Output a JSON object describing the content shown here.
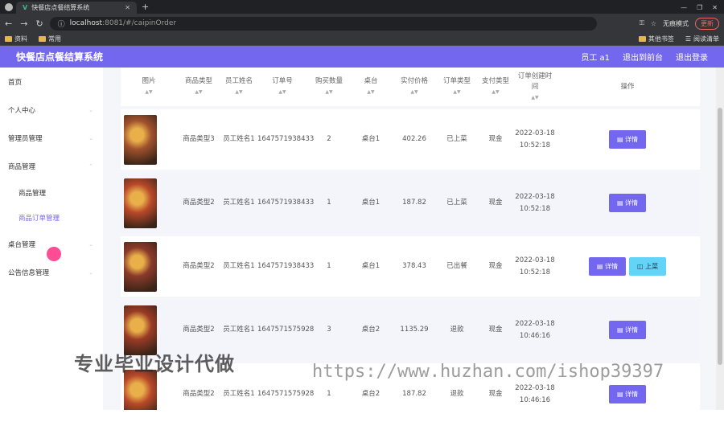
{
  "browser": {
    "tab_title": "快餐店点餐结算系统",
    "url_host": "localhost",
    "url_rest": ":8081/#/caipinOrder",
    "incognito": "无痕模式",
    "update": "更新",
    "bookmarks": [
      "资料",
      "常用"
    ],
    "bookmarks_right": [
      "其他书签",
      "阅读清单"
    ]
  },
  "app": {
    "title": "快餐店点餐结算系统",
    "user": "员工 a1",
    "back_front": "退出到前台",
    "logout": "退出登录"
  },
  "sidebar": {
    "items": [
      {
        "label": "首页"
      },
      {
        "label": "个人中心"
      },
      {
        "label": "管理员管理"
      },
      {
        "label": "商品管理"
      }
    ],
    "sub_items": [
      {
        "label": "商品管理"
      },
      {
        "label": "商品订单管理"
      }
    ],
    "items_after": [
      {
        "label": "桌台管理"
      },
      {
        "label": "公告信息管理"
      }
    ]
  },
  "table": {
    "headers": [
      "图片",
      "商品类型",
      "员工姓名",
      "订单号",
      "购买数量",
      "桌台",
      "实付价格",
      "订单类型",
      "支付类型",
      "订单创建时间",
      "操作"
    ],
    "rows": [
      {
        "img_color": "#a0522d",
        "type": "商品类型3",
        "staff": "员工姓名1",
        "order_no": "1647571938433",
        "qty": "2",
        "table": "桌台1",
        "price": "402.26",
        "order_type": "已上菜",
        "pay": "现金",
        "time": "2022-03-18 10:52:18",
        "actions": [
          "详情"
        ]
      },
      {
        "img_color": "#b8482a",
        "type": "商品类型2",
        "staff": "员工姓名1",
        "order_no": "1647571938433",
        "qty": "1",
        "table": "桌台1",
        "price": "187.82",
        "order_type": "已上菜",
        "pay": "现金",
        "time": "2022-03-18 10:52:18",
        "actions": [
          "详情"
        ]
      },
      {
        "img_color": "#8b3a2a",
        "type": "商品类型2",
        "staff": "员工姓名1",
        "order_no": "1647571938433",
        "qty": "1",
        "table": "桌台1",
        "price": "378.43",
        "order_type": "已出餐",
        "pay": "现金",
        "time": "2022-03-18 10:52:18",
        "actions": [
          "详情",
          "上菜"
        ]
      },
      {
        "img_color": "#9a3b25",
        "type": "商品类型2",
        "staff": "员工姓名1",
        "order_no": "1647571575928",
        "qty": "3",
        "table": "桌台2",
        "price": "1135.29",
        "order_type": "退款",
        "pay": "现金",
        "time": "2022-03-18 10:46:16",
        "actions": [
          "详情"
        ]
      },
      {
        "img_color": "#b8482a",
        "type": "商品类型2",
        "staff": "员工姓名1",
        "order_no": "1647571575928",
        "qty": "1",
        "table": "桌台2",
        "price": "187.82",
        "order_type": "退款",
        "pay": "现金",
        "time": "2022-03-18 10:46:16",
        "actions": [
          "详情"
        ]
      }
    ]
  },
  "watermark": {
    "text1": "专业毕业设计代做",
    "text2": "https://www.huzhan.com/ishop39397"
  }
}
